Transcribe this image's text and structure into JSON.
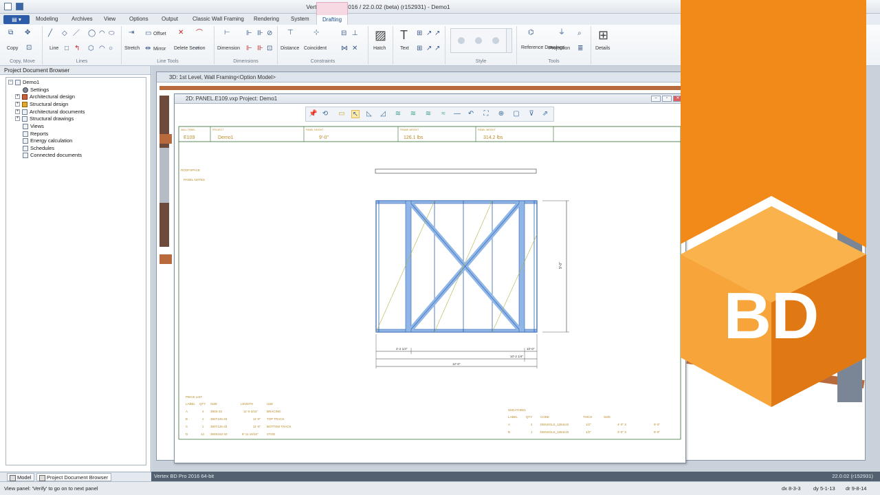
{
  "app": {
    "title": "Vertex BD Pro 2016 / 22.0.02 (beta) (r152931) - Demo1"
  },
  "ribbon": {
    "tabs": [
      "Modeling",
      "Archives",
      "View",
      "Options",
      "Output",
      "Classic Wall Framing",
      "Rendering",
      "System",
      "Drafting"
    ],
    "active_tab": "Drafting",
    "groups": {
      "copy_move": "Copy, Move",
      "lines": "Lines",
      "line_tools": "Line Tools",
      "dimensions": "Dimensions",
      "constraints": "Constraints",
      "style": "Style",
      "tools": "Tools"
    },
    "buttons": {
      "copy": "Copy",
      "line": "Line",
      "stretch": "Stretch",
      "offset": "Offset",
      "mirror": "Mirror",
      "delete_section": "Delete Section",
      "dimension": "Dimension",
      "distance": "Distance",
      "coincident": "Coincident",
      "hatch": "Hatch",
      "text": "Text",
      "reference_drawings": "Reference Drawings",
      "projection": "Projection",
      "details": "Details"
    }
  },
  "browser": {
    "title": "Project Document Browser",
    "root": "Demo1",
    "items": [
      "Settings",
      "Architectural design",
      "Structural design",
      "Architectural documents",
      "Structural drawings",
      "Views",
      "Reports",
      "Energy calculation",
      "Schedules",
      "Connected documents"
    ],
    "bottom_tabs": [
      "Model",
      "Project Document Browser"
    ]
  },
  "window3d": {
    "title": "3D: 1st Level, Wall Framing<Option Model>"
  },
  "window2d": {
    "title": "2D: PANEL.E109.vxp Project: Demo1",
    "header": {
      "wall_panel": "E109",
      "project": "Demo1",
      "panel_height": "9'-0\"",
      "frame_weight": "126.1 lbs",
      "panel_weight": "314.2 lbs"
    },
    "dimensions": {
      "height": "9'-0\"",
      "left": "2'-2 1/4\"",
      "right_top": "10'-0\"",
      "right_bottom": "10'-2 1/4\"",
      "overall": "12'-0\""
    },
    "side_notes": [
      "ROOFSPACE",
      "PANEL NOTES"
    ],
    "piece_list": {
      "title": "PIECE LIST",
      "columns": [
        "LABEL",
        "QTY",
        "SIZE",
        "LENGTH",
        "USE"
      ],
      "rows": [
        [
          "A",
          "4",
          "350S-33",
          "11'-9 3/16\"",
          "BRACING"
        ],
        [
          "B",
          "1",
          "350T125-33",
          "11'-9\"",
          "TOP TRACK"
        ],
        [
          "C",
          "1",
          "350T125-33",
          "11'-9\"",
          "BOTTOM TRACK"
        ],
        [
          "D",
          "12",
          "350S162-33",
          "8'-11 15/16\"",
          "STUD"
        ]
      ]
    },
    "sheathing": {
      "title": "SHEATHING",
      "columns": [
        "LABEL",
        "QTY",
        "CODE",
        "THICK",
        "SIZE"
      ],
      "rows": [
        [
          "A",
          "2",
          "DENSGLS_1284x10",
          "1/2\"",
          "4'-0\" X",
          "9'-0\""
        ],
        [
          "B",
          "1",
          "DENSGLS_1284x10",
          "1/2\"",
          "3'-0\" X",
          "9'-0\""
        ]
      ]
    }
  },
  "status": {
    "message": "View panel: 'Verify' to go on to next panel",
    "strip_left": "Vertex BD Pro 2016  64-bit",
    "strip_right": "22.0.02 (r152931)",
    "dx": "dx 8-3-3",
    "dy": "dy 5-1-13",
    "dr": "dr 9-8-14"
  },
  "badge": {
    "text": "BD",
    "colors": {
      "orange": "#f28a1a",
      "dark_orange": "#e07813",
      "light": "#f7a43a"
    }
  }
}
